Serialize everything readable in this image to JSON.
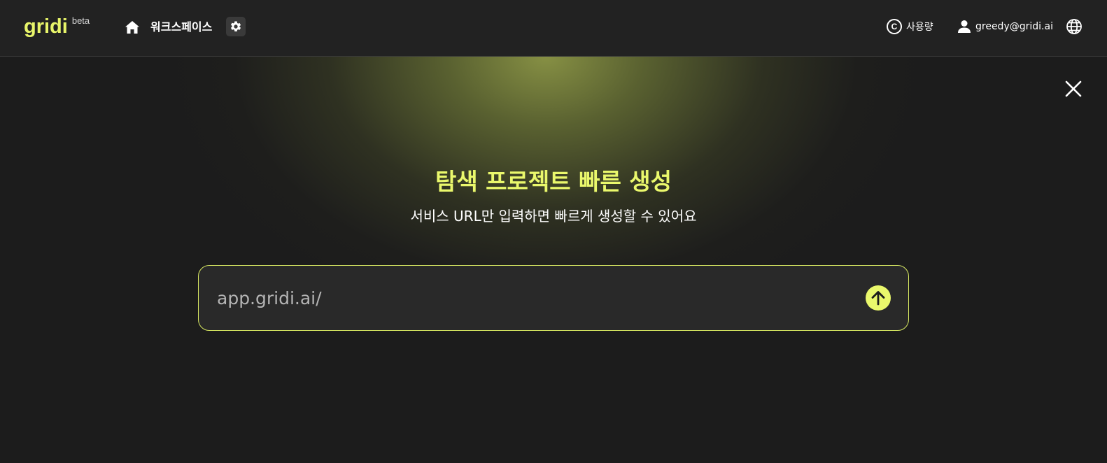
{
  "header": {
    "logo_text": "gridi",
    "logo_badge": "beta",
    "workspace_label": "워크스페이스",
    "usage_icon_glyph": "C",
    "usage_label": "사용량",
    "user_email": "greedy@gridi.ai"
  },
  "icons": {
    "home": "home-icon",
    "settings": "gear-icon",
    "usage": "copyright-circle-icon",
    "user": "person-icon",
    "language": "globe-icon",
    "close": "close-icon",
    "submit": "arrow-up-icon"
  },
  "main": {
    "title": "탐색 프로젝트 빠른 생성",
    "subtitle": "서비스 URL만 입력하면 빠르게 생성할 수 있어요",
    "url_placeholder": "app.gridi.ai/",
    "url_value": ""
  },
  "colors": {
    "accent": "#eaf86c",
    "header_bg": "#222222",
    "page_bg": "#1c1c1c",
    "input_bg": "#292929",
    "input_border": "#d9ea62"
  }
}
